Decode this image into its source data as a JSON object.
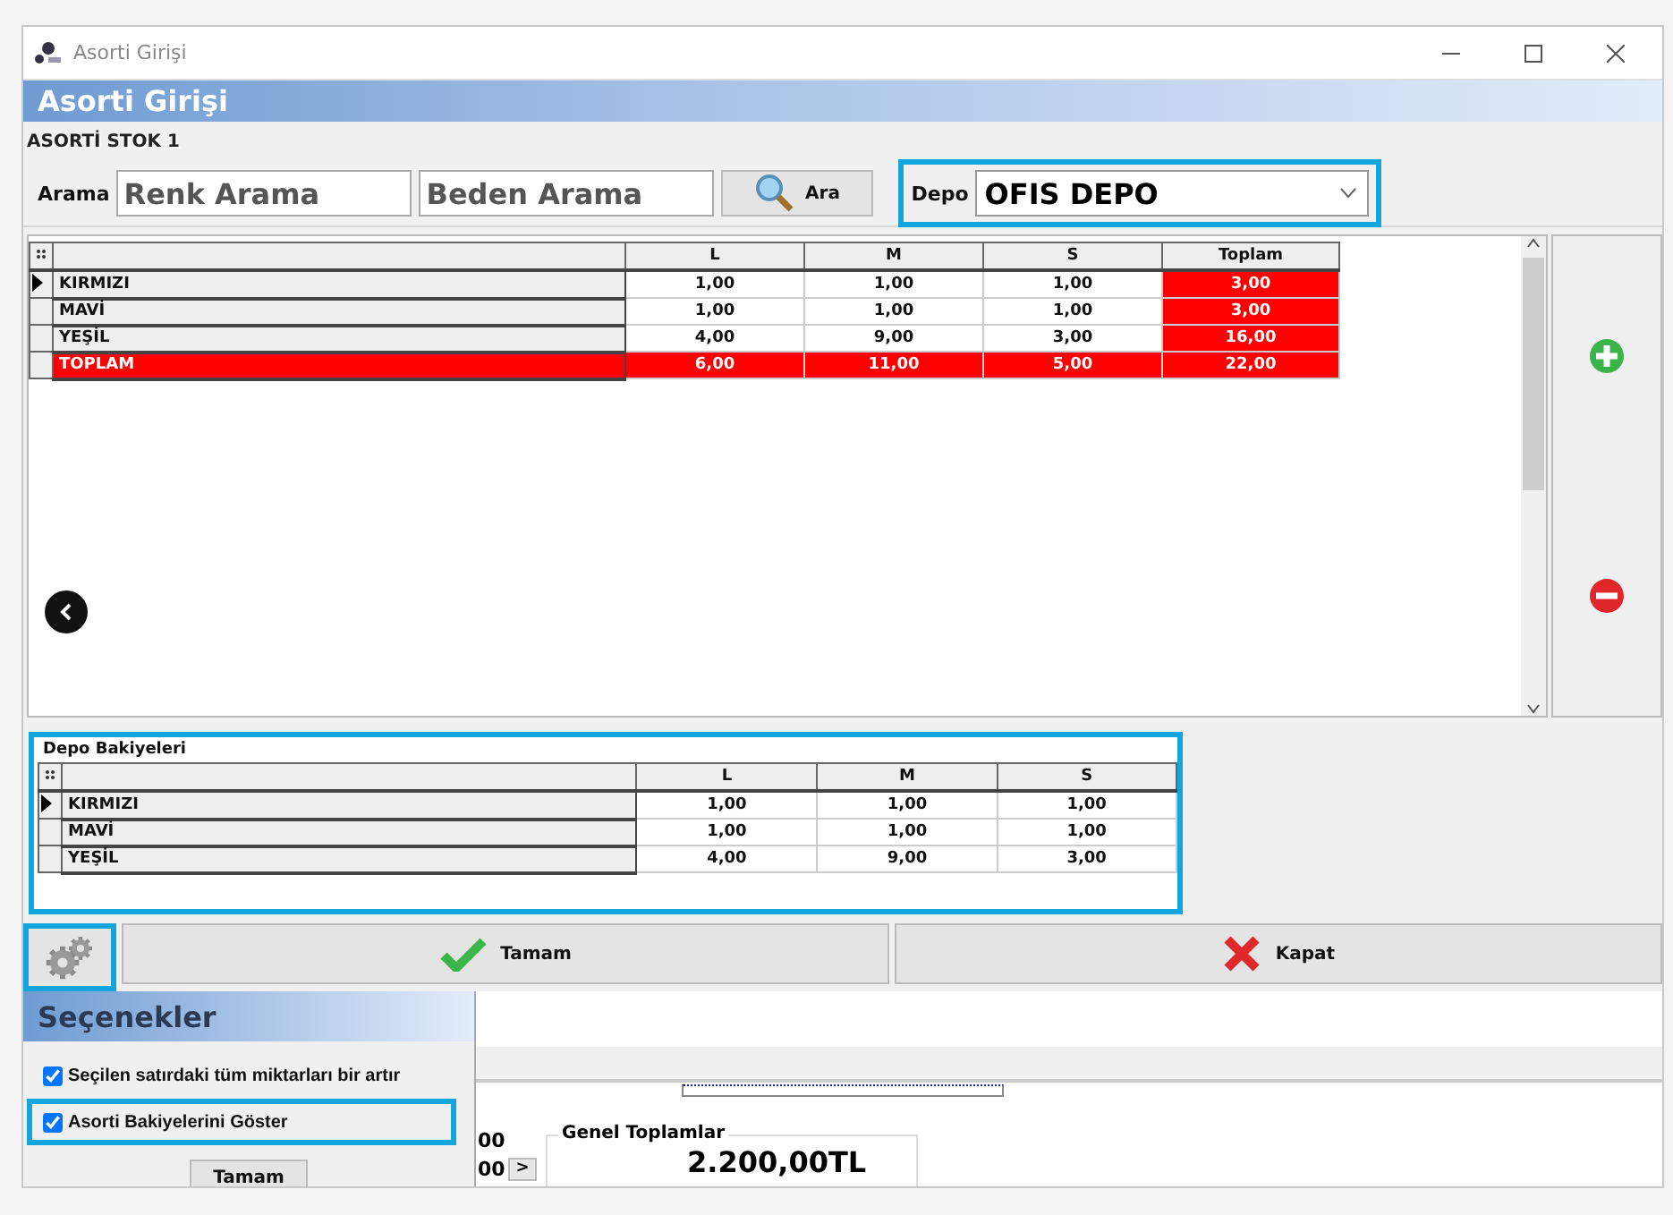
{
  "window": {
    "title": "Asorti Girişi"
  },
  "header": {
    "title": "Asorti Girişi"
  },
  "section_label": "ASORTİ STOK 1",
  "search": {
    "label": "Arama",
    "color_field": {
      "placeholder": "Renk Arama"
    },
    "size_field": {
      "placeholder": "Beden Arama"
    },
    "button": "Ara",
    "depot_label": "Depo",
    "depot_value": "OFIS DEPO",
    "highlighted": true
  },
  "grid": {
    "columns": [
      "L",
      "M",
      "S",
      "Toplam"
    ],
    "rows": [
      {
        "name": "KIRMIZI",
        "kind": "item",
        "current": true,
        "values": [
          "1,00",
          "1,00",
          "1,00"
        ],
        "total": "3,00"
      },
      {
        "name": "MAVİ",
        "kind": "item",
        "current": false,
        "values": [
          "1,00",
          "1,00",
          "1,00"
        ],
        "total": "3,00"
      },
      {
        "name": "YEŞİL",
        "kind": "item",
        "current": false,
        "values": [
          "4,00",
          "9,00",
          "3,00"
        ],
        "total": "16,00"
      },
      {
        "name": "TOPLAM",
        "kind": "total",
        "current": false,
        "values": [
          "6,00",
          "11,00",
          "5,00"
        ],
        "total": "22,00"
      }
    ]
  },
  "balances": {
    "title": "Depo Bakiyeleri",
    "highlighted": true,
    "columns": [
      "L",
      "M",
      "S"
    ],
    "rows": [
      {
        "name": "KIRMIZI",
        "current": true,
        "values": [
          "1,00",
          "1,00",
          "1,00"
        ]
      },
      {
        "name": "MAVİ",
        "current": false,
        "values": [
          "1,00",
          "1,00",
          "1,00"
        ]
      },
      {
        "name": "YEŞİL",
        "current": false,
        "values": [
          "4,00",
          "9,00",
          "3,00"
        ]
      }
    ]
  },
  "settings_button": {
    "highlighted": true
  },
  "buttons": [
    {
      "label": "Tamam",
      "kind": "ok"
    },
    {
      "label": "Kapat",
      "kind": "cancel"
    }
  ],
  "options_popup": {
    "title": "Seçenekler",
    "options": [
      {
        "label": "Seçilen satırdaki tüm miktarları bir artır",
        "checked": true,
        "highlighted": false
      },
      {
        "label": "Asorti Bakiyelerini Göster",
        "checked": true,
        "highlighted": true
      }
    ],
    "button": "Tamam"
  },
  "background": {
    "values": [
      "00",
      "00"
    ],
    "next_button": ">",
    "totals": {
      "title": "Genel Toplamlar",
      "value": "2.200,00TL"
    }
  }
}
